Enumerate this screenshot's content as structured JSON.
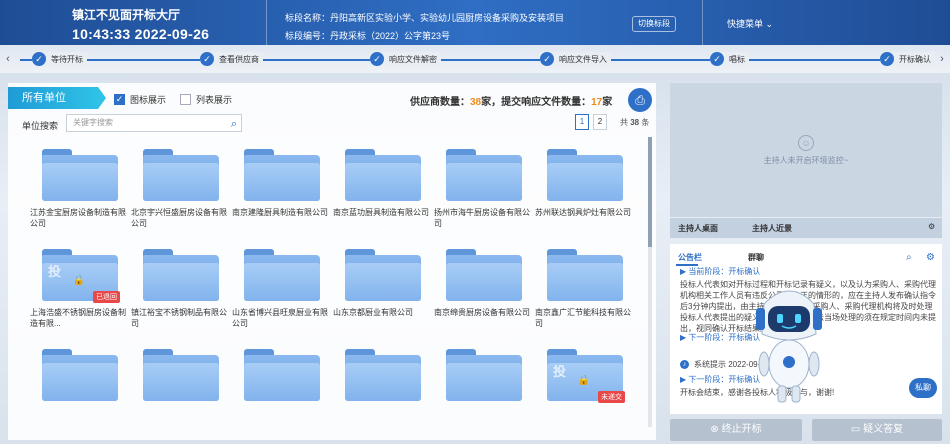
{
  "header": {
    "hall_title": "镇江不见面开标大厅",
    "clock": "10:43:33 2022-09-26",
    "section_name_label": "标段名称：",
    "section_name": "丹阳高新区实验小学、实验幼儿园厨房设备采购及安装项目",
    "section_no_label": "标段编号：",
    "section_no": "丹政采标（2022）公字第23号",
    "switch_label": "切换标段",
    "quick_menu": "快捷菜单",
    "quick_caret": "⌄"
  },
  "steps": [
    {
      "label": "等待开标"
    },
    {
      "label": "查看供应商"
    },
    {
      "label": "响应文件解密"
    },
    {
      "label": "响应文件导入"
    },
    {
      "label": "唱标"
    },
    {
      "label": "开标确认"
    }
  ],
  "toolbar": {
    "unit_tag": "所有单位",
    "icon_view": "图标展示",
    "list_view": "列表展示",
    "count_prefix": "供应商数量：",
    "supplier_count": "38",
    "count_mid": "家，提交响应文件数量：",
    "file_count": "17",
    "count_suffix": "家",
    "search_label": "单位搜索",
    "search_placeholder": "关键字搜索",
    "page1": "1",
    "page2": "2",
    "total_prefix": "共",
    "total_count": "38",
    "total_suffix": "条"
  },
  "folders": [
    {
      "name": "江苏金宝厨房设备制造有限公司",
      "locked": false
    },
    {
      "name": "北京宇兴恒盛厨房设备有限公司",
      "locked": false
    },
    {
      "name": "南京建隆厨具制造有限公司",
      "locked": false
    },
    {
      "name": "南京蓝功厨具制造有限公司",
      "locked": false
    },
    {
      "name": "扬州市海牛厨房设备有限公司",
      "locked": false
    },
    {
      "name": "苏州联达钢具炉灶有限公司",
      "locked": false
    },
    {
      "name": "上海浩盛不锈钢厨房设备制造有限...",
      "locked": true,
      "badge": "已退回"
    },
    {
      "name": "镇江裕宝不锈钢制品有限公司",
      "locked": false
    },
    {
      "name": "山东省博兴县旺泉厨业有限公司",
      "locked": false
    },
    {
      "name": "山东京都厨业有限公司",
      "locked": false
    },
    {
      "name": "南京绵贵厨房设备有限公司",
      "locked": false
    },
    {
      "name": "南京鑫广汇节能科技有限公司",
      "locked": false
    },
    {
      "name": "",
      "locked": false
    },
    {
      "name": "",
      "locked": false
    },
    {
      "name": "",
      "locked": false
    },
    {
      "name": "",
      "locked": false
    },
    {
      "name": "",
      "locked": false
    },
    {
      "name": "",
      "locked": true,
      "badge": "未递交"
    }
  ],
  "folder_lock_char": "投",
  "video": {
    "text": "主持人未开启环境监控~"
  },
  "host_tabs": {
    "desk": "主持人桌面",
    "near": "主持人近景"
  },
  "notice": {
    "tab1": "公告栏",
    "tab2": "群聊",
    "phase1": "当前阶段：开标确认",
    "body1": "投标人代表如对开标过程和开标记录有疑义，以及认为采购人、采购代理机构相关工作人员有违反公平、公正的情形的，应在主持人发布确认指令后3分钟内提出，由主持人记录在案；采购人、采购代理机构将及时处理投标人代表提出的疑义或有关事宜，无法当场处理的须在规定时间内未提出，视同确认开标结果。",
    "next_phase": "下一阶段：开标确认",
    "sys_label": "系统提示",
    "sys_time": "2022-09-26",
    "sys_body": "开标会结束，感谢各投标人积极参与，谢谢!",
    "chat_btn": "私聊"
  },
  "buttons": {
    "end": "终止开标",
    "reply": "疑义答复"
  },
  "colors": {
    "primary": "#2e6fc8",
    "header": "#1f4d95",
    "accent": "#f08a1c",
    "danger": "#e84848"
  }
}
